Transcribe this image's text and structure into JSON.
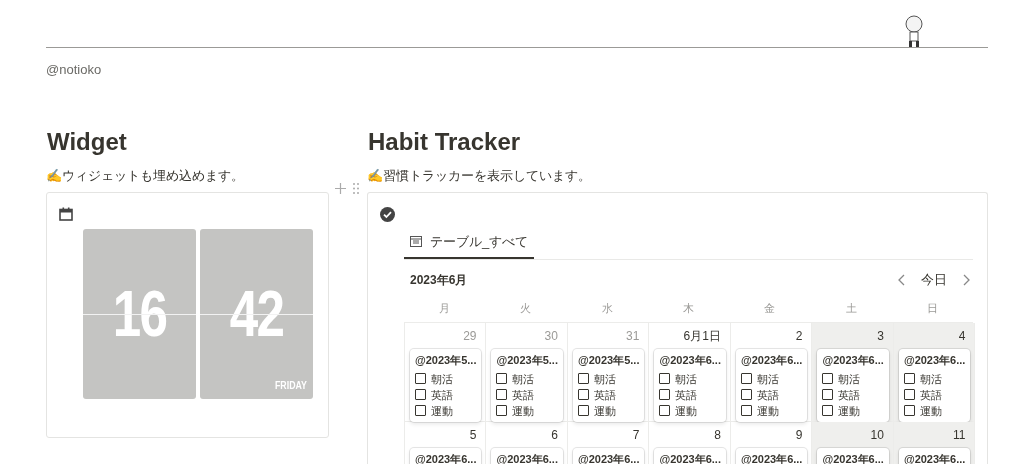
{
  "handle": "@notioko",
  "widget": {
    "heading": "Widget",
    "note": "✍️ウィジェットも埋め込めます。",
    "clock": {
      "hours": "16",
      "minutes": "42",
      "weekday": "FRIDAY"
    }
  },
  "tracker": {
    "heading": "Habit Tracker",
    "note": "✍️習慣トラッカーを表示しています。",
    "view_tab": {
      "label": "テーブル_すべて",
      "selected": true
    },
    "month": "2023年6月",
    "today_button": "今日",
    "weekdays": [
      "月",
      "火",
      "水",
      "木",
      "金",
      "土",
      "日"
    ],
    "weeks": [
      {
        "days": [
          {
            "date": "29",
            "muted": true,
            "weekend": false,
            "events": [
              {
                "title": "@2023年5...",
                "tasks": [
                  {
                    "label": "朝活",
                    "checked": false
                  },
                  {
                    "label": "英語",
                    "checked": false
                  },
                  {
                    "label": "運動",
                    "checked": false
                  }
                ]
              }
            ]
          },
          {
            "date": "30",
            "muted": true,
            "weekend": false,
            "events": [
              {
                "title": "@2023年5...",
                "tasks": [
                  {
                    "label": "朝活",
                    "checked": false
                  },
                  {
                    "label": "英語",
                    "checked": false
                  },
                  {
                    "label": "運動",
                    "checked": false
                  }
                ]
              }
            ]
          },
          {
            "date": "31",
            "muted": true,
            "weekend": false,
            "events": [
              {
                "title": "@2023年5...",
                "tasks": [
                  {
                    "label": "朝活",
                    "checked": false
                  },
                  {
                    "label": "英語",
                    "checked": false
                  },
                  {
                    "label": "運動",
                    "checked": false
                  }
                ]
              }
            ]
          },
          {
            "date": "6月1日",
            "muted": false,
            "weekend": false,
            "events": [
              {
                "title": "@2023年6...",
                "tasks": [
                  {
                    "label": "朝活",
                    "checked": false
                  },
                  {
                    "label": "英語",
                    "checked": false
                  },
                  {
                    "label": "運動",
                    "checked": false
                  }
                ]
              }
            ]
          },
          {
            "date": "2",
            "muted": false,
            "weekend": false,
            "events": [
              {
                "title": "@2023年6...",
                "tasks": [
                  {
                    "label": "朝活",
                    "checked": false
                  },
                  {
                    "label": "英語",
                    "checked": false
                  },
                  {
                    "label": "運動",
                    "checked": false
                  }
                ]
              }
            ]
          },
          {
            "date": "3",
            "muted": false,
            "weekend": true,
            "events": [
              {
                "title": "@2023年6...",
                "tasks": [
                  {
                    "label": "朝活",
                    "checked": false
                  },
                  {
                    "label": "英語",
                    "checked": false
                  },
                  {
                    "label": "運動",
                    "checked": false
                  }
                ]
              }
            ]
          },
          {
            "date": "4",
            "muted": false,
            "weekend": true,
            "events": [
              {
                "title": "@2023年6...",
                "tasks": [
                  {
                    "label": "朝活",
                    "checked": false
                  },
                  {
                    "label": "英語",
                    "checked": false
                  },
                  {
                    "label": "運動",
                    "checked": false
                  }
                ]
              }
            ]
          }
        ]
      },
      {
        "days": [
          {
            "date": "5",
            "muted": false,
            "weekend": false,
            "events": [
              {
                "title": "@2023年6..."
              }
            ]
          },
          {
            "date": "6",
            "muted": false,
            "weekend": false,
            "events": [
              {
                "title": "@2023年6..."
              }
            ]
          },
          {
            "date": "7",
            "muted": false,
            "weekend": false,
            "events": [
              {
                "title": "@2023年6..."
              }
            ]
          },
          {
            "date": "8",
            "muted": false,
            "weekend": false,
            "events": [
              {
                "title": "@2023年6..."
              }
            ]
          },
          {
            "date": "9",
            "muted": false,
            "weekend": false,
            "events": [
              {
                "title": "@2023年6..."
              }
            ]
          },
          {
            "date": "10",
            "muted": false,
            "weekend": true,
            "events": [
              {
                "title": "@2023年6..."
              }
            ]
          },
          {
            "date": "11",
            "muted": false,
            "weekend": true,
            "events": [
              {
                "title": "@2023年6..."
              }
            ]
          }
        ]
      }
    ]
  }
}
